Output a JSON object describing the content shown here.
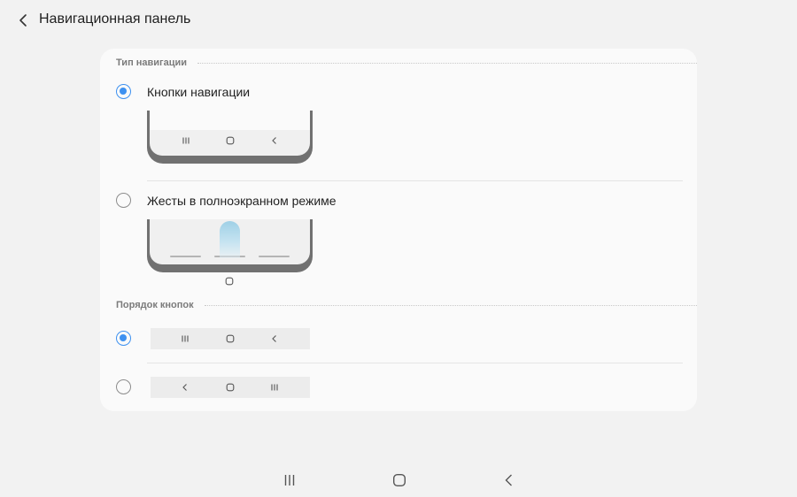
{
  "header": {
    "title": "Навигационная панель",
    "back_icon": "chevron-left-icon"
  },
  "nav_type": {
    "section_label": "Тип навигации",
    "options": [
      {
        "label": "Кнопки навигации",
        "selected": true
      },
      {
        "label": "Жесты в полноэкранном режиме",
        "selected": false
      }
    ]
  },
  "button_order": {
    "section_label": "Порядок кнопок",
    "options": [
      {
        "order": [
          "recent-apps-icon",
          "home-icon",
          "back-icon"
        ],
        "selected": true
      },
      {
        "order": [
          "back-icon",
          "home-icon",
          "recent-apps-icon"
        ],
        "selected": false
      }
    ]
  },
  "system_nav": {
    "buttons": [
      "recent-apps-icon",
      "home-icon",
      "back-icon"
    ]
  },
  "colors": {
    "accent": "#3e91f0",
    "background": "#f2f2f2",
    "card": "#fafafa"
  }
}
